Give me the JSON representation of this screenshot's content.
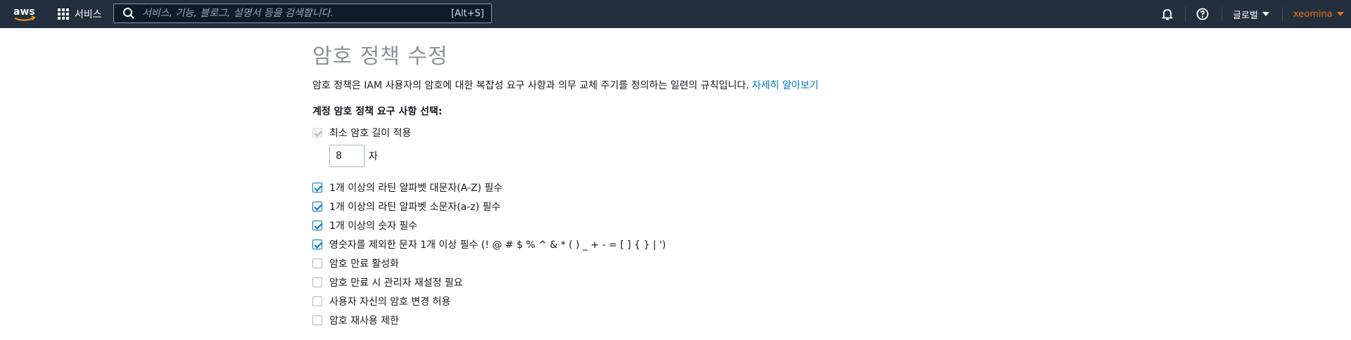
{
  "nav": {
    "logo_text": "aws",
    "services_label": "서비스",
    "search_placeholder": "서비스, 기능, 블로그, 설명서 등을 검색합니다.",
    "search_shortcut": "[Alt+S]",
    "region_label": "글로벌",
    "user_label": "xeomina",
    "colors": {
      "bg": "#232f3e",
      "user": "#ec7211"
    }
  },
  "page": {
    "title": "암호 정책 수정",
    "description": "암호 정책은 IAM 사용자의 암호에 대한 복잡성 요구 사항과 의무 교체 주기를 정의하는 일련의 규칙입니다.",
    "learn_more": "자세히 알아보기",
    "section_label": "계정 암호 정책 요구 사항 선택:",
    "min_length": {
      "label": "최소 암호 길이 적용",
      "checked": true,
      "disabled": true,
      "value": "8",
      "unit": "자"
    },
    "options": [
      {
        "label": "1개 이상의 라틴 알파벳 대문자(A-Z) 필수",
        "checked": true
      },
      {
        "label": "1개 이상의 라틴 알파벳 소문자(a-z) 필수",
        "checked": true
      },
      {
        "label": "1개 이상의 숫자 필수",
        "checked": true
      },
      {
        "label": "영숫자를 제외한 문자 1개 이상 필수 (! @ # $ % ^ & * ( ) _ + - = [ ] { } | ')",
        "checked": true
      },
      {
        "label": "암호 만료 활성화",
        "checked": false
      },
      {
        "label": "암호 만료 시 관리자 재설정 필요",
        "checked": false
      },
      {
        "label": "사용자 자신의 암호 변경 허용",
        "checked": false
      },
      {
        "label": "암호 재사용 제한",
        "checked": false
      }
    ]
  }
}
